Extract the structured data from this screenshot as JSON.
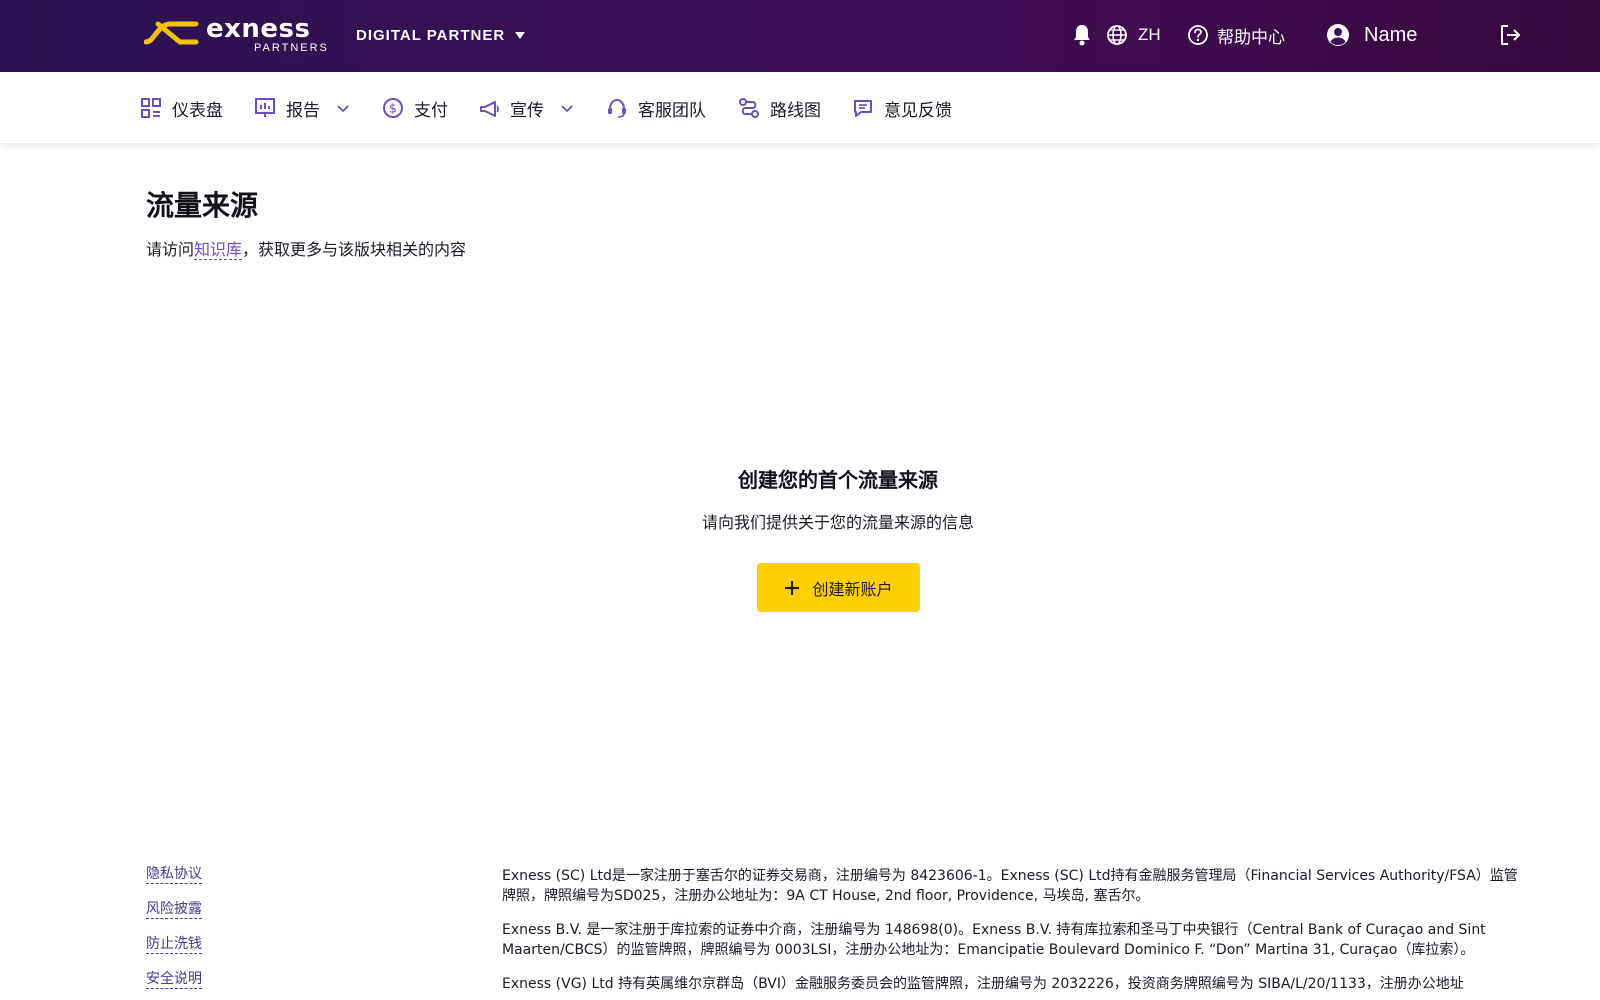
{
  "header": {
    "brand": "exness",
    "brand_sub": "PARTNERS",
    "partner_type": "DIGITAL PARTNER",
    "language": "ZH",
    "help": "帮助中心",
    "user_name": "Name",
    "icons": [
      "bell-icon",
      "globe-icon",
      "help-icon",
      "user-icon",
      "logout-icon"
    ]
  },
  "nav": {
    "items": [
      {
        "label": "仪表盘",
        "icon": "dashboard-icon"
      },
      {
        "label": "报告",
        "icon": "report-icon",
        "dropdown": true
      },
      {
        "label": "支付",
        "icon": "dollar-icon"
      },
      {
        "label": "宣传",
        "icon": "megaphone-icon",
        "dropdown": true
      },
      {
        "label": "客服团队",
        "icon": "support-icon"
      },
      {
        "label": "路线图",
        "icon": "roadmap-icon"
      },
      {
        "label": "意见反馈",
        "icon": "feedback-icon"
      }
    ]
  },
  "page": {
    "title": "流量来源",
    "sub_prefix": "请访问",
    "sub_link": "知识库",
    "sub_suffix": "，获取更多与该版块相关的内容"
  },
  "empty_state": {
    "title": "创建您的首个流量来源",
    "description": "请向我们提供关于您的流量来源的信息",
    "button": "创建新账户"
  },
  "footer": {
    "links": [
      "隐私协议",
      "风险披露",
      "防止洗钱",
      "安全说明"
    ],
    "paragraphs": [
      "Exness (SC) Ltd是一家注册于塞舌尔的证券交易商，注册编号为 8423606-1。Exness (SC) Ltd持有金融服务管理局（Financial Services Authority/FSA）监管牌照，牌照编号为SD025，注册办公地址为：9A CT House, 2nd floor, Providence, 马埃岛, 塞舌尔。",
      "Exness B.V. 是一家注册于库拉索的证券中介商，注册编号为 148698(0)。Exness B.V. 持有库拉索和圣马丁中央银行（Central Bank of Curaçao and Sint Maarten/CBCS）的监管牌照，牌照编号为 0003LSI，注册办公地址为：Emancipatie Boulevard Dominico F. “Don” Martina 31, Curaçao（库拉索）。",
      "Exness (VG) Ltd 持有英属维尔京群岛（BVI）金融服务委员会的监管牌照，注册编号为 2032226，投资商务牌照编号为 SIBA/L/20/1133，注册办公地址"
    ]
  },
  "colors": {
    "header_bg": "#3b0f57",
    "accent_purple": "#6b4fbf",
    "button_yellow": "#ffcf01"
  }
}
